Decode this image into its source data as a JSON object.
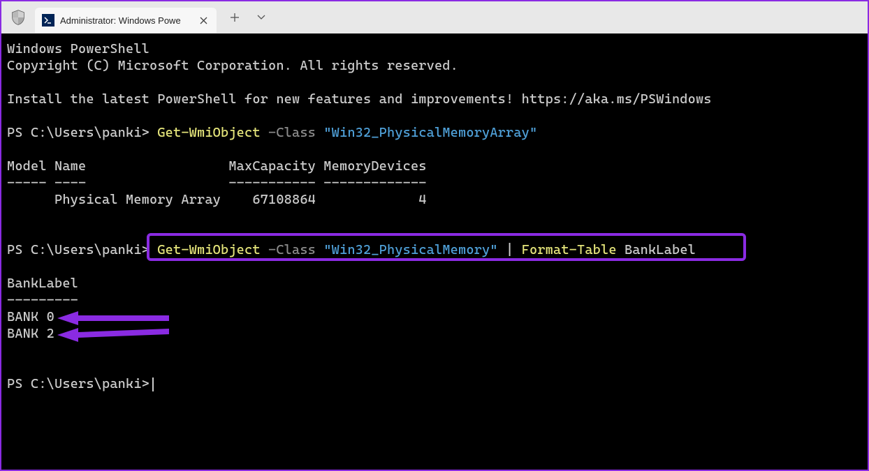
{
  "window": {
    "tab_title": "Administrator: Windows Powe"
  },
  "terminal": {
    "line1": "Windows PowerShell",
    "line2": "Copyright (C) Microsoft Corporation. All rights reserved.",
    "line3": "Install the latest PowerShell for new features and improvements! https://aka.ms/PSWindows",
    "prompt1_path": "PS C:\\Users\\panki> ",
    "cmd1_cmdlet": "Get-WmiObject",
    "cmd1_param": " -Class ",
    "cmd1_string": "\"Win32_PhysicalMemoryArray\"",
    "table1_header": "Model Name                  MaxCapacity MemoryDevices",
    "table1_divider": "----- ----                  ----------- -------------",
    "table1_row": "      Physical Memory Array    67108864             4",
    "prompt2_path": "PS C:\\Users\\panki> ",
    "cmd2_cmdlet": "Get-WmiObject",
    "cmd2_param": " -Class ",
    "cmd2_string": "\"Win32_PhysicalMemory\"",
    "cmd2_pipe": " | ",
    "cmd2_cmdlet2": "Format-Table",
    "cmd2_arg": " BankLabel",
    "table2_header": "BankLabel",
    "table2_divider": "---------",
    "table2_row1": "BANK 0",
    "table2_row2": "BANK 2",
    "prompt3_path": "PS C:\\Users\\panki>"
  }
}
